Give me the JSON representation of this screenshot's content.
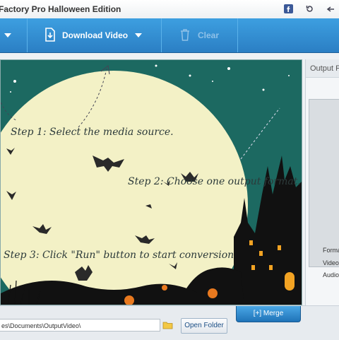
{
  "window": {
    "title": "Factory Pro Halloween Edition",
    "controls": [
      "facebook-icon",
      "refresh-icon",
      "back-icon"
    ]
  },
  "toolbar": {
    "download_label": "Download Video",
    "clear_label": "Clear"
  },
  "stage": {
    "step1": "Step 1: Select the media source.",
    "step2": "Step 2: Choose one output format.",
    "step3": "Step 3: Click \"Run\" button to start conversion"
  },
  "side_panel": {
    "header": "Output F",
    "format_label": "Format",
    "video_label": "Video",
    "audio_label": "Audio"
  },
  "bottom": {
    "output_path": "es\\Documents\\OutputVideo\\",
    "open_folder_label": "Open Folder",
    "merge_label": "[+] Merge"
  },
  "colors": {
    "toolbar_blue": "#2b7fc4",
    "stage_teal": "#1c6961",
    "moon": "#f3f1c6"
  }
}
